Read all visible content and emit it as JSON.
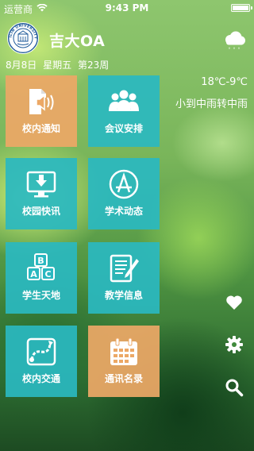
{
  "status_bar": {
    "carrier": "运营商",
    "time": "9:43 PM",
    "wifi_icon": "wifi-icon",
    "battery_icon": "battery-icon"
  },
  "header": {
    "logo_icon": "university-seal-icon",
    "logo_text": "JILIN UNIVERSITY",
    "title": "吉大OA",
    "date": "8月8日",
    "weekday": "星期五",
    "week": "第23周"
  },
  "weather": {
    "icon": "rain-cloud-icon",
    "temperature": "18℃-9℃",
    "description": "小到中雨转中雨"
  },
  "tiles": [
    {
      "label": "校内通知",
      "icon": "announcement-speaker-icon",
      "color": "#eca866"
    },
    {
      "label": "会议安排",
      "icon": "meeting-people-icon",
      "color": "#2ab8c0"
    },
    {
      "label": "校园快讯",
      "icon": "monitor-download-icon",
      "color": "#2ab8c0"
    },
    {
      "label": "学术动态",
      "icon": "app-store-a-icon",
      "color": "#2ab8c0"
    },
    {
      "label": "学生天地",
      "icon": "abc-blocks-icon",
      "color": "#2ab8c0"
    },
    {
      "label": "教学信息",
      "icon": "document-pen-icon",
      "color": "#2ab8c0"
    },
    {
      "label": "校内交通",
      "icon": "map-route-icon",
      "color": "#2ab8c0"
    },
    {
      "label": "通讯名录",
      "icon": "calendar-contacts-icon",
      "color": "#eca866"
    }
  ],
  "side_actions": [
    {
      "icon": "heart-icon"
    },
    {
      "icon": "gear-icon"
    },
    {
      "icon": "search-icon"
    }
  ]
}
